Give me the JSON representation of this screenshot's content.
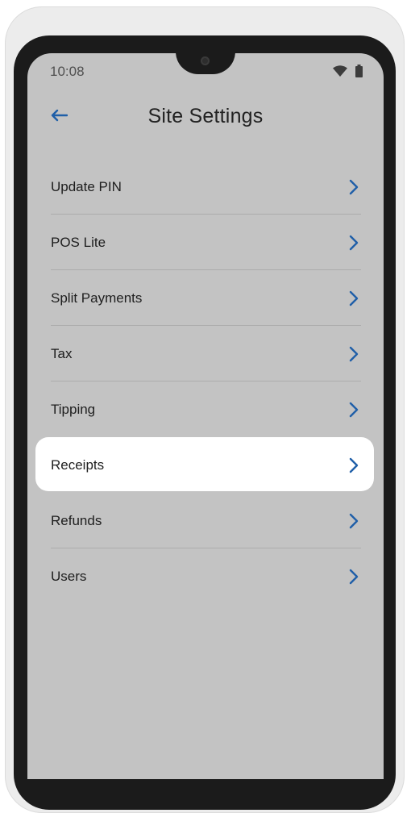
{
  "status_bar": {
    "time": "10:08",
    "icons": [
      "wifi-icon",
      "battery-icon"
    ]
  },
  "header": {
    "title": "Site Settings",
    "back_icon": "arrow-left-icon"
  },
  "menu": {
    "items": [
      {
        "label": "Update PIN",
        "selected": false
      },
      {
        "label": "POS Lite",
        "selected": false
      },
      {
        "label": "Split Payments",
        "selected": false
      },
      {
        "label": "Tax",
        "selected": false
      },
      {
        "label": "Tipping",
        "selected": false
      },
      {
        "label": "Receipts",
        "selected": true
      },
      {
        "label": "Refunds",
        "selected": false
      },
      {
        "label": "Users",
        "selected": false
      }
    ],
    "chevron_icon": "chevron-right-icon"
  },
  "colors": {
    "accent": "#1f5fa8",
    "screen_background": "#c3c3c3",
    "selected_background": "#ffffff"
  }
}
